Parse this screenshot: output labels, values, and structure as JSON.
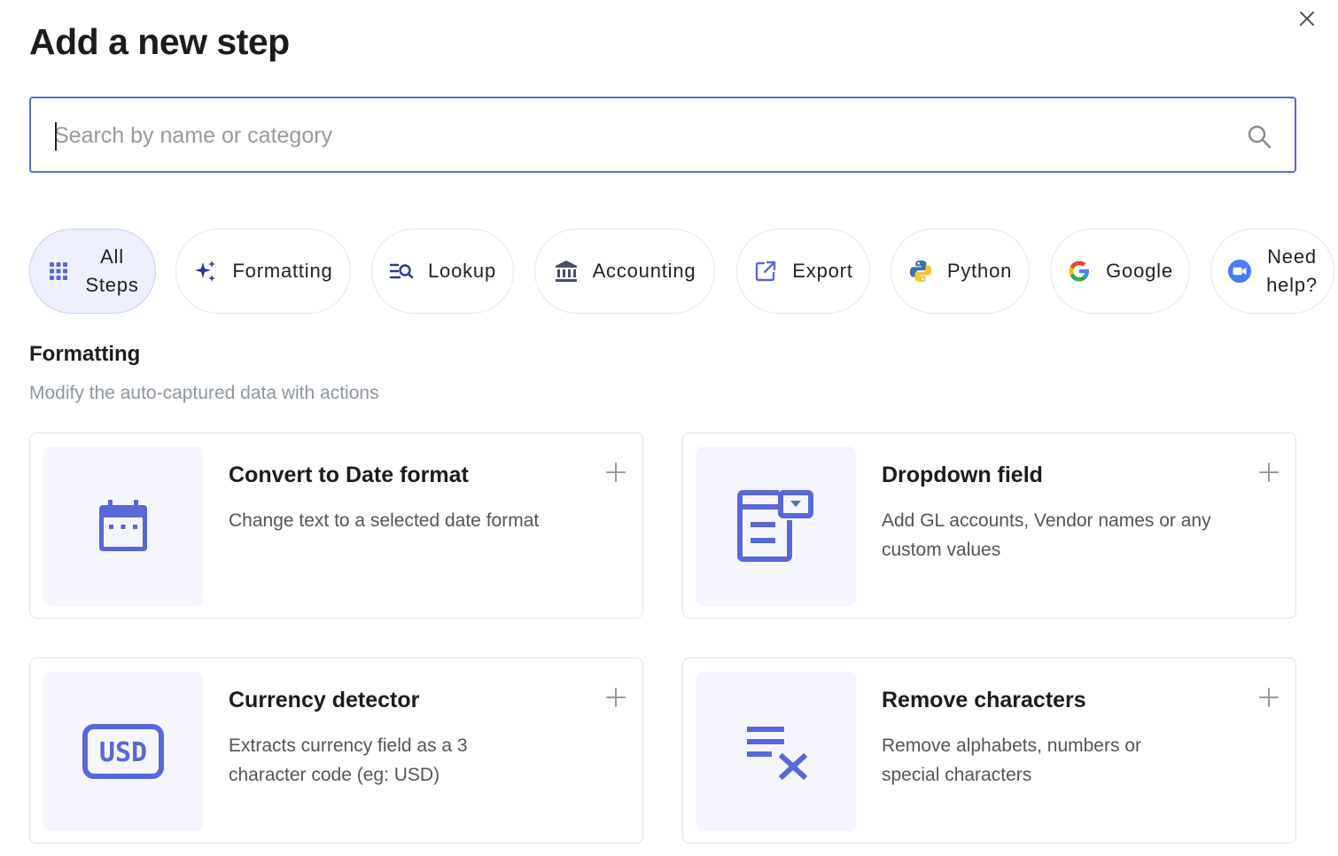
{
  "dialog": {
    "title": "Add a new step"
  },
  "search": {
    "placeholder": "Search by name or category"
  },
  "chips": [
    {
      "line1": "All",
      "line2": "Steps",
      "icon": "grid-icon"
    },
    {
      "label": "Formatting",
      "icon": "sparkles-icon"
    },
    {
      "label": "Lookup",
      "icon": "list-search-icon"
    },
    {
      "label": "Accounting",
      "icon": "bank-icon"
    },
    {
      "label": "Export",
      "icon": "external-link-icon"
    },
    {
      "label": "Python",
      "icon": "python-icon"
    },
    {
      "label": "Google",
      "icon": "google-icon"
    },
    {
      "line1": "Need",
      "line2": "help?",
      "icon": "video-call-icon"
    }
  ],
  "section": {
    "title": "Formatting",
    "subtitle": "Modify the auto-captured data with actions"
  },
  "cards": [
    {
      "title": "Convert to Date format",
      "description": "Change text to a selected date format",
      "icon": "calendar-icon"
    },
    {
      "title": "Dropdown field",
      "description": "Add GL accounts, Vendor names or any custom values",
      "icon": "dropdown-field-icon"
    },
    {
      "title": "Currency detector",
      "description": "Extracts currency field as a 3 character code (eg: USD)",
      "icon": "usd-icon",
      "icon_text": "USD"
    },
    {
      "title": "Remove characters",
      "description": "Remove alphabets, numbers or special characters",
      "icon": "clear-text-icon"
    }
  ],
  "colors": {
    "accent": "#5a67d8",
    "chip_active_bg": "#eef0fd",
    "thumb_bg": "#f5f5fd"
  }
}
